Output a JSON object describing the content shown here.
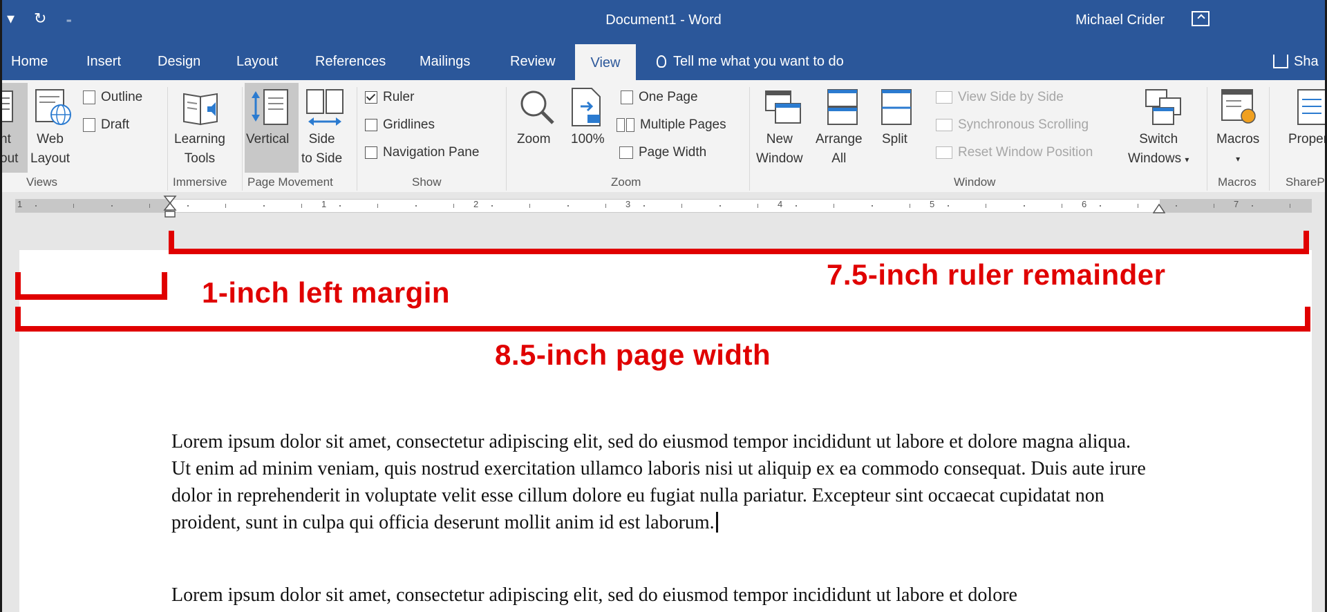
{
  "window": {
    "title": "Document1  -  Word",
    "user": "Michael Crider"
  },
  "tabs": [
    "Home",
    "Insert",
    "Design",
    "Layout",
    "References",
    "Mailings",
    "Review",
    "View"
  ],
  "active_tab": "View",
  "tell_me": "Tell me what you want to do",
  "share_label": "Sha",
  "ribbon": {
    "views": {
      "label": "Views",
      "print_layout_line1": "nt",
      "print_layout_line2": "out",
      "web_layout_line1": "Web",
      "web_layout_line2": "Layout",
      "outline": "Outline",
      "draft": "Draft"
    },
    "immersive": {
      "label": "Immersive",
      "learning_tools_line1": "Learning",
      "learning_tools_line2": "Tools"
    },
    "page_movement": {
      "label": "Page Movement",
      "vertical": "Vertical",
      "side_line1": "Side",
      "side_line2": "to Side"
    },
    "show": {
      "label": "Show",
      "ruler": "Ruler",
      "gridlines": "Gridlines",
      "navigation_pane": "Navigation Pane",
      "ruler_checked": true,
      "gridlines_checked": false,
      "navigation_pane_checked": false
    },
    "zoom": {
      "label": "Zoom",
      "zoom": "Zoom",
      "hundred": "100%",
      "one_page": "One Page",
      "multiple_pages": "Multiple Pages",
      "page_width": "Page Width"
    },
    "window": {
      "label": "Window",
      "new_window_line1": "New",
      "new_window_line2": "Window",
      "arrange_all_line1": "Arrange",
      "arrange_all_line2": "All",
      "split": "Split",
      "view_side_by_side": "View Side by Side",
      "synchronous_scrolling": "Synchronous Scrolling",
      "reset_window_position": "Reset Window Position",
      "switch_windows_line1": "Switch",
      "switch_windows_line2": "Windows"
    },
    "macros": {
      "label": "Macros",
      "macros": "Macros"
    },
    "sharepoint": {
      "label": "SharePo",
      "properties": "Proper"
    }
  },
  "ruler_numbers": [
    "1",
    "1",
    "2",
    "3",
    "4",
    "5",
    "6",
    "7"
  ],
  "annotations": {
    "left_margin": "1-inch left margin",
    "ruler_remainder": "7.5-inch ruler remainder",
    "page_width": "8.5-inch page width"
  },
  "document": {
    "paragraph1": "Lorem ipsum dolor sit amet, consectetur adipiscing elit, sed do eiusmod tempor incididunt ut labore et dolore magna aliqua. Ut enim ad minim veniam, quis nostrud exercitation ullamco laboris nisi ut aliquip ex ea commodo consequat. Duis aute irure dolor in reprehenderit in voluptate velit esse cillum dolore eu fugiat nulla pariatur. Excepteur sint occaecat cupidatat non proident, sunt in culpa qui officia deserunt mollit anim id est laborum.",
    "paragraph2": "Lorem ipsum dolor sit amet, consectetur adipiscing elit, sed do eiusmod tempor incididunt ut labore et dolore"
  },
  "colors": {
    "title_bar": "#2b579a",
    "ribbon_bg": "#f3f3f3",
    "annotation_red": "#e00000"
  }
}
